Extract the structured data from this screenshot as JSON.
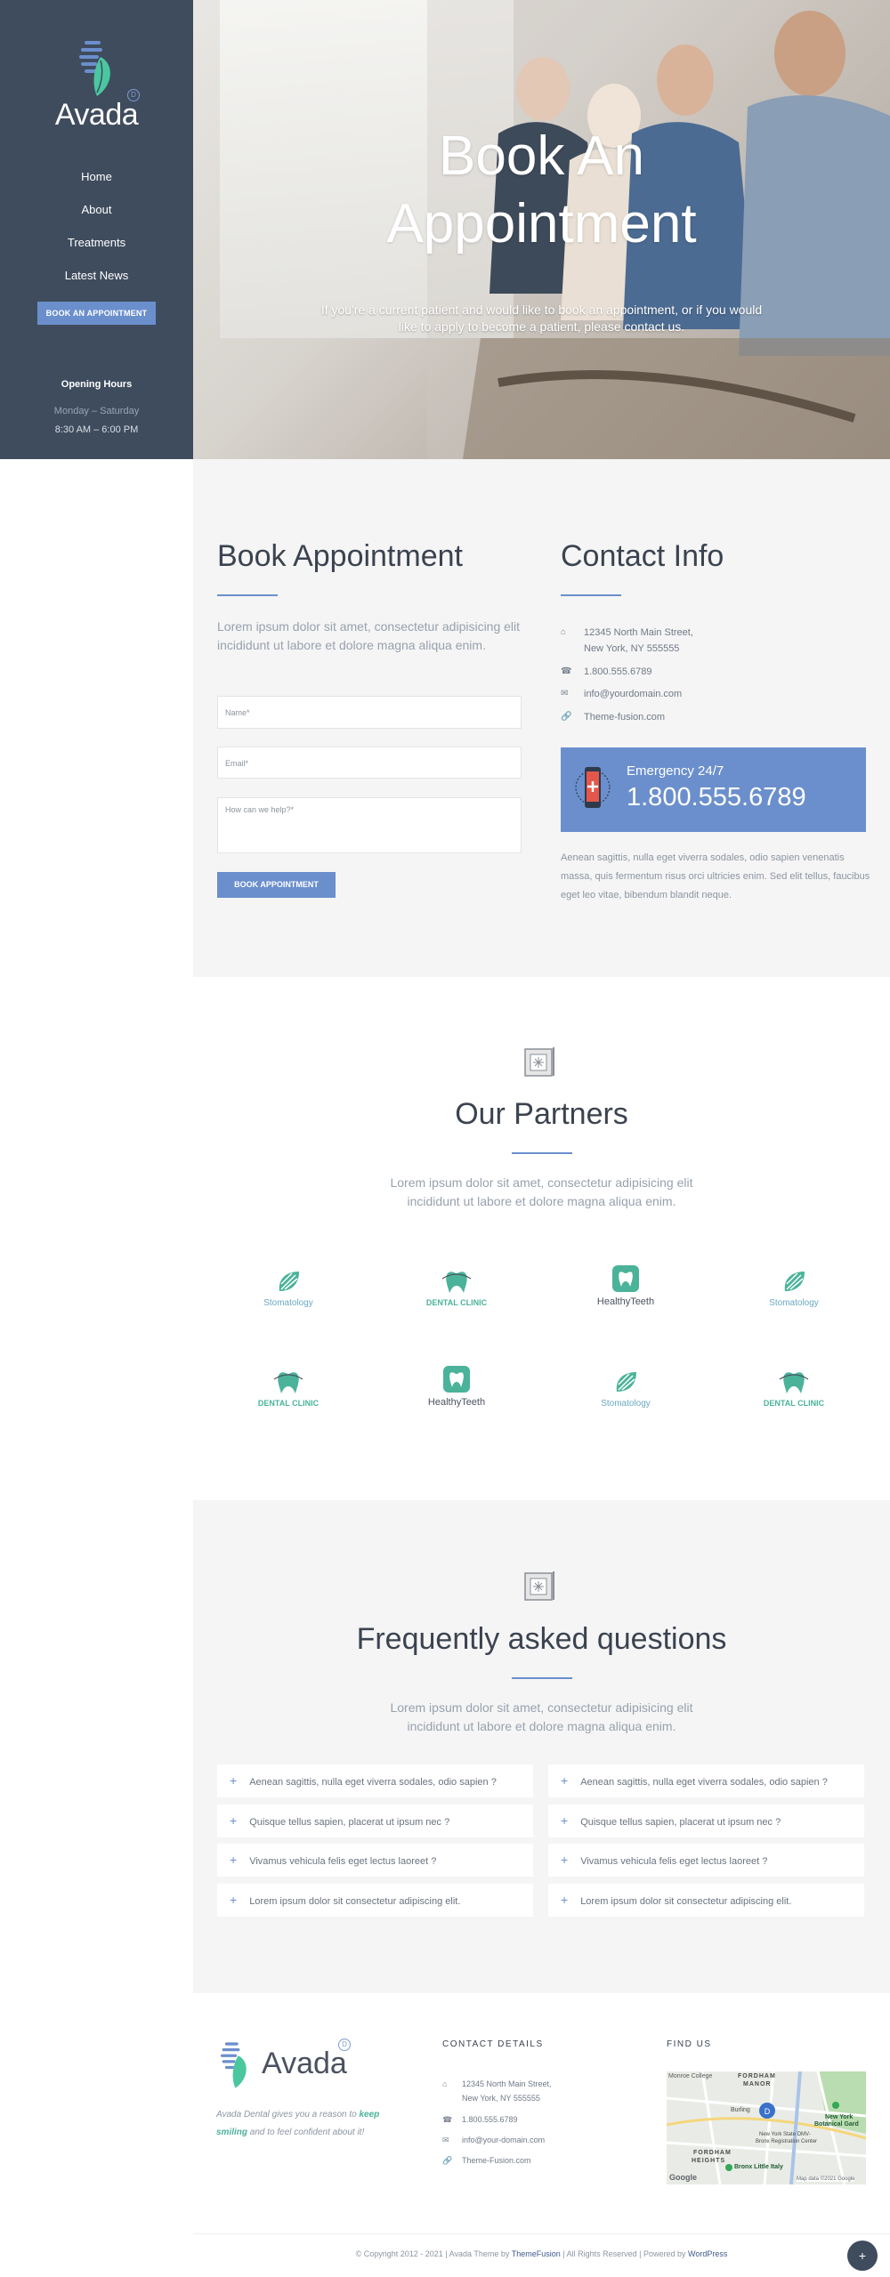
{
  "sidebar": {
    "logo_text": "Avada",
    "logo_badge": "D",
    "nav": [
      "Home",
      "About",
      "Treatments",
      "Latest News"
    ],
    "cta": "BOOK AN APPOINTMENT",
    "hours_title": "Opening Hours",
    "hours_days": "Monday – Saturday",
    "hours_time": "8:30 AM – 6:00 PM"
  },
  "hero": {
    "title_line1": "Book An",
    "title_line2": "Appointment",
    "subtitle": "If you're a current patient and would like to book an appointment, or if you would like to apply to become a patient, please contact us."
  },
  "appointment": {
    "title": "Book Appointment",
    "lead": "Lorem ipsum dolor sit amet, consectetur adipisicing elit incididunt ut labore et dolore magna aliqua enim.",
    "name_placeholder": "Name*",
    "email_placeholder": "Email*",
    "help_placeholder": "How can we help?*",
    "button": "BOOK APPOINTMENT"
  },
  "contact": {
    "title": "Contact Info",
    "address_line1": "12345 North Main Street,",
    "address_line2": "New York, NY 555555",
    "phone": "1.800.555.6789",
    "email": "info@yourdomain.com",
    "website": "Theme-fusion.com",
    "emergency_label": "Emergency 24/7",
    "emergency_number": "1.800.555.6789",
    "paragraph": "Aenean sagittis, nulla eget viverra sodales, odio sapien venenatis massa, quis fermentum risus orci ultricies enim. Sed elit tellus, faucibus eget leo vitae, bibendum blandit neque."
  },
  "partners": {
    "title": "Our Partners",
    "lead": "Lorem ipsum dolor sit amet, consectetur adipisicing elit incididunt ut labore et dolore magna aliqua enim.",
    "row1": [
      "Stomatology",
      "DENTAL CLINIC",
      "HealthyTeeth",
      "Stomatology"
    ],
    "row2": [
      "DENTAL CLINIC",
      "HealthyTeeth",
      "Stomatology",
      "DENTAL CLINIC"
    ]
  },
  "faq": {
    "title": "Frequently asked questions",
    "lead": "Lorem ipsum dolor sit amet, consectetur adipisicing elit incididunt ut labore et dolore magna aliqua enim.",
    "left": [
      "Aenean sagittis, nulla eget viverra sodales, odio sapien ?",
      "Quisque tellus sapien, placerat ut ipsum nec ?",
      "Vivamus vehicula felis eget lectus laoreet ?",
      "Lorem ipsum dolor sit consectetur adipiscing elit."
    ],
    "right": [
      "Aenean sagittis, nulla eget viverra sodales, odio sapien ?",
      "Quisque tellus sapien, placerat ut ipsum nec ?",
      "Vivamus vehicula felis eget lectus laoreet ?",
      "Lorem ipsum dolor sit consectetur adipiscing elit."
    ]
  },
  "footer": {
    "logo_text": "Avada",
    "logo_badge": "D",
    "tagline_pre": "Avada Dental gives you a reason to ",
    "tagline_bold1": "keep",
    "tagline_bold2": "smiling",
    "tagline_post": " and to feel confident about it!",
    "contact_head": "CONTACT DETAILS",
    "address_line1": "12345 North Main Street,",
    "address_line2": "New York, NY 555555",
    "phone": "1.800.555.6789",
    "email": "info@your-domain.com",
    "website": "Theme-Fusion.com",
    "find_head": "FIND US",
    "map_labels": [
      "Monroe College",
      "FORDHAM",
      "MANOR",
      "Burling",
      "New York",
      "Botanical Gard",
      "New York State DMV-",
      "Bronx Registration Center",
      "FORDHAM",
      "HEIGHTS",
      "Bronx Little Italy",
      "Google",
      "Map data ©2021 Google"
    ],
    "copyright_pre": "© Copyright 2012 - 2021 | Avada Theme by ",
    "copyright_link1": "ThemeFusion",
    "copyright_mid": " | All Rights Reserved | Powered by ",
    "copyright_link2": "WordPress",
    "to_top": "+"
  },
  "colors": {
    "sidebar_bg": "#3f4c5e",
    "accent_blue": "#6b8fcc",
    "accent_green": "#4bb39a",
    "section_bg": "#f5f5f5"
  }
}
